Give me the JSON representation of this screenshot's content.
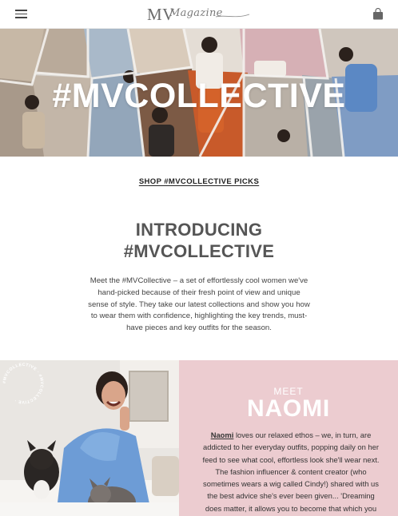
{
  "header": {
    "menu_icon": "hamburger-menu-icon",
    "logo_mv": "MV",
    "logo_script": "Magazine",
    "bag_icon": "shopping-bag-icon"
  },
  "hero": {
    "title": "#MVCOLLECTIVE",
    "image": "collage-of-women-photos"
  },
  "shop_link": "SHOP #MVCOLLECTIVE PICKS",
  "intro": {
    "title_line1": "INTRODUCING",
    "title_line2": "#MVCOLLECTIVE",
    "body": "Meet the #MVCollective – a set of effortlessly cool women we've hand-picked because of their fresh point of view and unique sense of style. They take our latest collections and show you how to wear them with confidence, highlighting the key trends, must-have pieces and key outfits for the season."
  },
  "feature": {
    "badge_text": "#MVCOLLECTIVE · #MVCOLLECTIVE ·",
    "meet": "MEET",
    "name": "NAOMI",
    "lead_name": "Naomi",
    "body": " loves our relaxed ethos – we, in turn, are addicted to her everyday outfits, popping daily on her feed to see what cool, effortless look she'll wear next. The fashion influencer & content creator (who sometimes wears a wig called Cindy!) shared with us the best advice she's ever been given... 'Dreaming does matter, it allows you to become that which you aspire to.'",
    "photo": "woman-in-blue-shirt-with-french-bulldogs"
  },
  "colors": {
    "panel_pink": "#ecccd0",
    "text_dark": "#333333",
    "title_gray": "#555555"
  }
}
